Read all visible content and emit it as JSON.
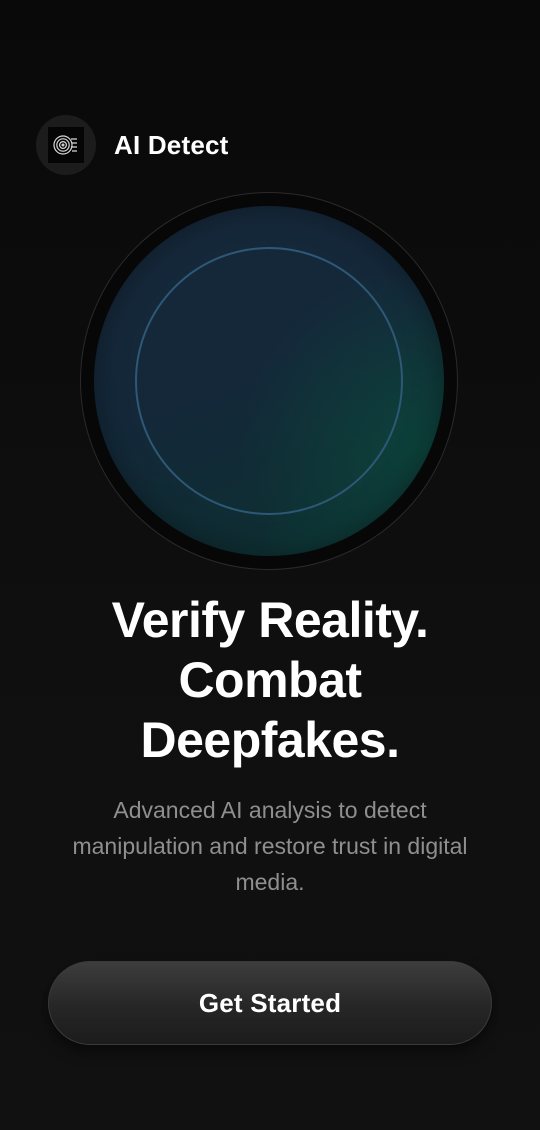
{
  "app": {
    "name": "AI Detect",
    "logo_icon": "fingerprint-scan-icon"
  },
  "hero": {
    "icon": "scan-orb-icon"
  },
  "headline": {
    "line1": "Verify Reality.",
    "line2": "Combat",
    "line3": "Deepfakes."
  },
  "subtitle": "Advanced AI analysis to detect manipulation and restore trust in digital media.",
  "cta": {
    "label": "Get Started"
  },
  "colors": {
    "background": "#0c0c0c",
    "orb_blue": "#16283a",
    "orb_teal": "#0b3a34",
    "ring": "#2d5876",
    "subtitle_text": "#8f8f8f"
  }
}
